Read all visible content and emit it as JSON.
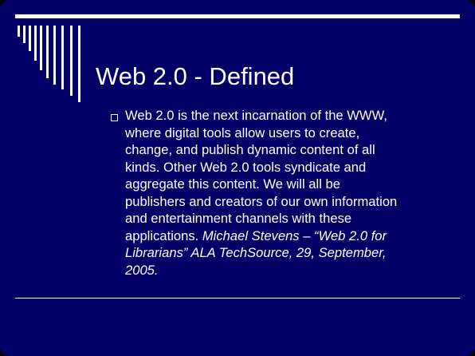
{
  "slide": {
    "title": "Web 2.0 - Defined",
    "bullet": {
      "lines": [
        "Web 2.0 is the next incarnation of the WWW,",
        "where digital tools allow users to create,",
        "change, and publish dynamic content of all",
        "kinds.  Other Web 2.0 tools syndicate and",
        "aggregate this content.  We will all be",
        "publishers and creators of our own information",
        "and entertainment channels with these"
      ],
      "mixed_line_plain": "applications. ",
      "mixed_line_italic": "Michael Stevens – “Web 2.0 for",
      "italic_lines": [
        "Librarians” ALA TechSource, 29, September,",
        "2005."
      ]
    }
  },
  "colors": {
    "background": "#000066",
    "text": "#ffffff",
    "accent_lines": "#ffffff"
  },
  "icons": {
    "bullet": "hollow-square-bullet-icon",
    "decoration": "vertical-stripes-decoration"
  }
}
